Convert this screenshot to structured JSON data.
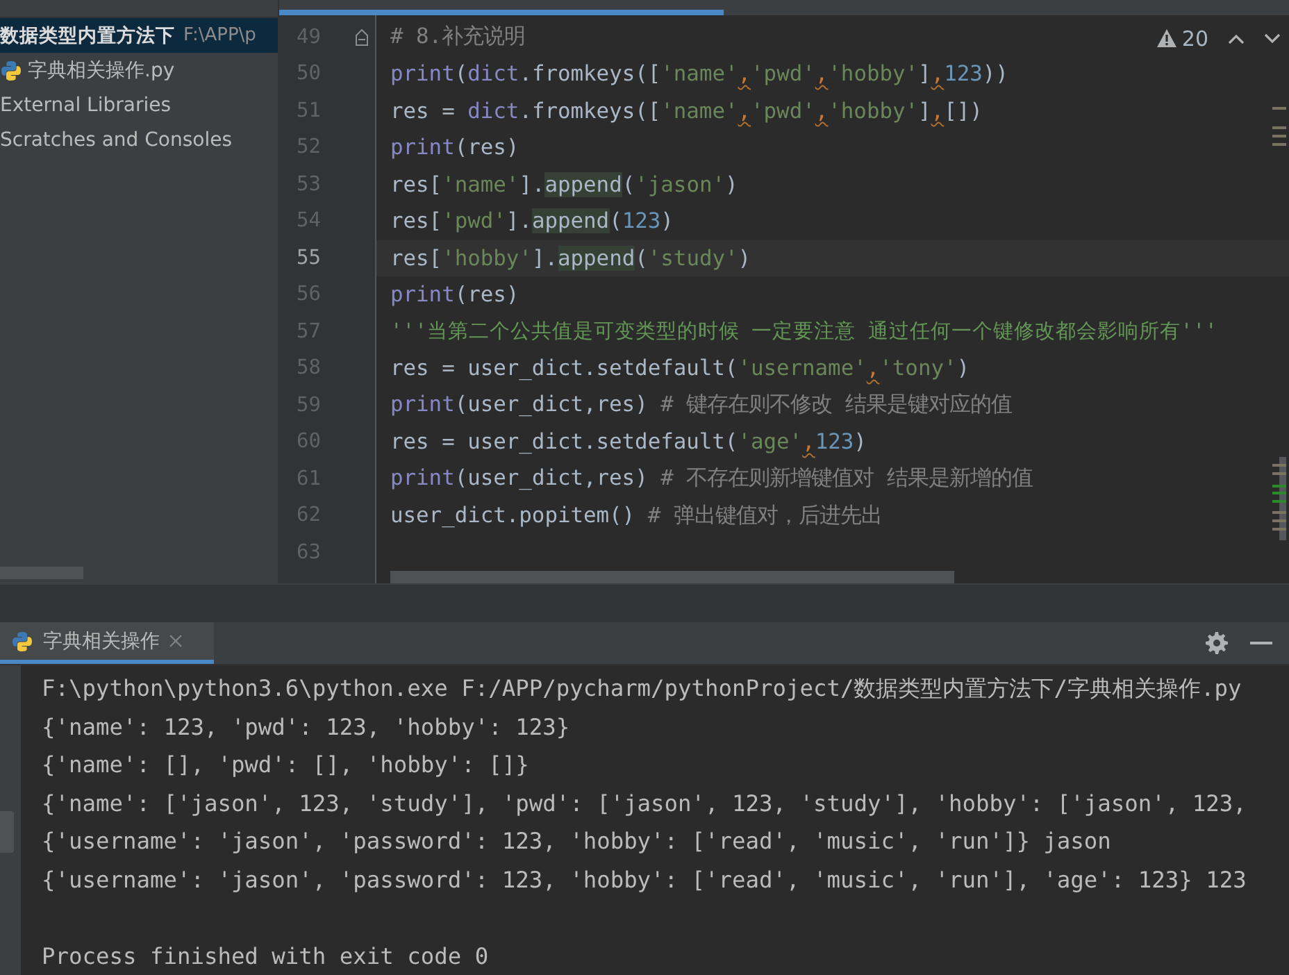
{
  "sidebar": {
    "items": [
      {
        "label": "数据类型内置方法下",
        "path": "F:\\APP\\p",
        "kind": "folder",
        "selected": true
      },
      {
        "label": "字典相关操作.py",
        "kind": "python-file",
        "selected": false
      },
      {
        "label": "External Libraries",
        "kind": "library",
        "selected": false
      },
      {
        "label": "Scratches and Consoles",
        "kind": "scratch",
        "selected": false
      }
    ]
  },
  "editor": {
    "inspections": {
      "count": "20"
    },
    "lines": [
      {
        "number": "49",
        "fold": true,
        "current": false,
        "segments": [
          {
            "kind": "comment",
            "text": "# 8.补充说明"
          }
        ]
      },
      {
        "number": "50",
        "fold": false,
        "current": false,
        "segments": [
          {
            "kind": "builtin",
            "text": "print"
          },
          {
            "kind": "plain",
            "text": "("
          },
          {
            "kind": "builtin",
            "text": "dict"
          },
          {
            "kind": "plain",
            "text": ".fromkeys(["
          },
          {
            "kind": "string",
            "text": "'name'"
          },
          {
            "kind": "warn",
            "text": ","
          },
          {
            "kind": "string",
            "text": "'pwd'"
          },
          {
            "kind": "warn",
            "text": ","
          },
          {
            "kind": "string",
            "text": "'hobby'"
          },
          {
            "kind": "plain",
            "text": "]"
          },
          {
            "kind": "warn",
            "text": ","
          },
          {
            "kind": "number",
            "text": "123"
          },
          {
            "kind": "plain",
            "text": "))"
          }
        ]
      },
      {
        "number": "51",
        "fold": false,
        "current": false,
        "segments": [
          {
            "kind": "plain",
            "text": "res = "
          },
          {
            "kind": "builtin",
            "text": "dict"
          },
          {
            "kind": "plain",
            "text": ".fromkeys(["
          },
          {
            "kind": "string",
            "text": "'name'"
          },
          {
            "kind": "warn",
            "text": ","
          },
          {
            "kind": "string",
            "text": "'pwd'"
          },
          {
            "kind": "warn",
            "text": ","
          },
          {
            "kind": "string",
            "text": "'hobby'"
          },
          {
            "kind": "plain",
            "text": "]"
          },
          {
            "kind": "warn",
            "text": ","
          },
          {
            "kind": "plain",
            "text": "[])"
          }
        ]
      },
      {
        "number": "52",
        "fold": false,
        "current": false,
        "segments": [
          {
            "kind": "builtin",
            "text": "print"
          },
          {
            "kind": "plain",
            "text": "(res)"
          }
        ]
      },
      {
        "number": "53",
        "fold": false,
        "current": false,
        "segments": [
          {
            "kind": "plain",
            "text": "res["
          },
          {
            "kind": "string",
            "text": "'name'"
          },
          {
            "kind": "plain",
            "text": "]."
          },
          {
            "kind": "match",
            "text": "append"
          },
          {
            "kind": "plain",
            "text": "("
          },
          {
            "kind": "string",
            "text": "'jason'"
          },
          {
            "kind": "plain",
            "text": ")"
          }
        ]
      },
      {
        "number": "54",
        "fold": false,
        "current": false,
        "segments": [
          {
            "kind": "plain",
            "text": "res["
          },
          {
            "kind": "string",
            "text": "'pwd'"
          },
          {
            "kind": "plain",
            "text": "]."
          },
          {
            "kind": "match",
            "text": "append"
          },
          {
            "kind": "plain",
            "text": "("
          },
          {
            "kind": "number",
            "text": "123"
          },
          {
            "kind": "plain",
            "text": ")"
          }
        ]
      },
      {
        "number": "55",
        "fold": false,
        "current": true,
        "segments": [
          {
            "kind": "plain",
            "text": "res["
          },
          {
            "kind": "string",
            "text": "'hobby'"
          },
          {
            "kind": "plain",
            "text": "]."
          },
          {
            "kind": "match",
            "text": "append"
          },
          {
            "kind": "plain",
            "text": "("
          },
          {
            "kind": "string",
            "text": "'study'"
          },
          {
            "kind": "plain",
            "text": ")"
          }
        ]
      },
      {
        "number": "56",
        "fold": false,
        "current": false,
        "segments": [
          {
            "kind": "builtin",
            "text": "print"
          },
          {
            "kind": "plain",
            "text": "(res)"
          }
        ]
      },
      {
        "number": "57",
        "fold": false,
        "current": false,
        "segments": [
          {
            "kind": "docstring",
            "text": "'''当第二个公共值是可变类型的时候 一定要注意 通过任何一个键修改都会影响所有'''"
          }
        ]
      },
      {
        "number": "58",
        "fold": false,
        "current": false,
        "segments": [
          {
            "kind": "plain",
            "text": "res = user_dict.setdefault("
          },
          {
            "kind": "string",
            "text": "'username'"
          },
          {
            "kind": "warn",
            "text": ","
          },
          {
            "kind": "string",
            "text": "'tony'"
          },
          {
            "kind": "plain",
            "text": ")"
          }
        ]
      },
      {
        "number": "59",
        "fold": false,
        "current": false,
        "segments": [
          {
            "kind": "builtin",
            "text": "print"
          },
          {
            "kind": "plain",
            "text": "(user_dict,res)"
          },
          {
            "kind": "comment",
            "text": " # 键存在则不修改 结果是键对应的值"
          }
        ]
      },
      {
        "number": "60",
        "fold": false,
        "current": false,
        "segments": [
          {
            "kind": "plain",
            "text": "res = user_dict.setdefault("
          },
          {
            "kind": "string",
            "text": "'age'"
          },
          {
            "kind": "warn",
            "text": ","
          },
          {
            "kind": "number",
            "text": "123"
          },
          {
            "kind": "plain",
            "text": ")"
          }
        ]
      },
      {
        "number": "61",
        "fold": false,
        "current": false,
        "segments": [
          {
            "kind": "builtin",
            "text": "print"
          },
          {
            "kind": "plain",
            "text": "(user_dict,res)"
          },
          {
            "kind": "comment",
            "text": " # 不存在则新增键值对 结果是新增的值"
          }
        ]
      },
      {
        "number": "62",
        "fold": false,
        "current": false,
        "segments": [
          {
            "kind": "plain",
            "text": "user_dict.popitem()"
          },
          {
            "kind": "comment",
            "text": " # 弹出键值对，后进先出"
          }
        ]
      },
      {
        "number": "63",
        "fold": false,
        "current": false
      }
    ]
  },
  "run_panel": {
    "tab": {
      "label": "字典相关操作",
      "selected": true
    },
    "output": [
      {
        "kind": "stdout",
        "text": "F:\\python\\python3.6\\python.exe F:/APP/pycharm/pythonProject/数据类型内置方法下/字典相关操作.py"
      },
      {
        "kind": "stdout",
        "text": "{'name': 123, 'pwd': 123, 'hobby': 123}"
      },
      {
        "kind": "stdout",
        "text": "{'name': [], 'pwd': [], 'hobby': []}"
      },
      {
        "kind": "stdout",
        "text": "{'name': ['jason', 123, 'study'], 'pwd': ['jason', 123, 'study'], 'hobby': ['jason', 123,"
      },
      {
        "kind": "stdout",
        "text": "{'username': 'jason', 'password': 123, 'hobby': ['read', 'music', 'run']} jason"
      },
      {
        "kind": "stdout",
        "text": "{'username': 'jason', 'password': 123, 'hobby': ['read', 'music', 'run'], 'age': 123} 123"
      },
      {
        "kind": "blank"
      },
      {
        "kind": "stdout",
        "text": "Process finished with exit code 0"
      }
    ]
  }
}
